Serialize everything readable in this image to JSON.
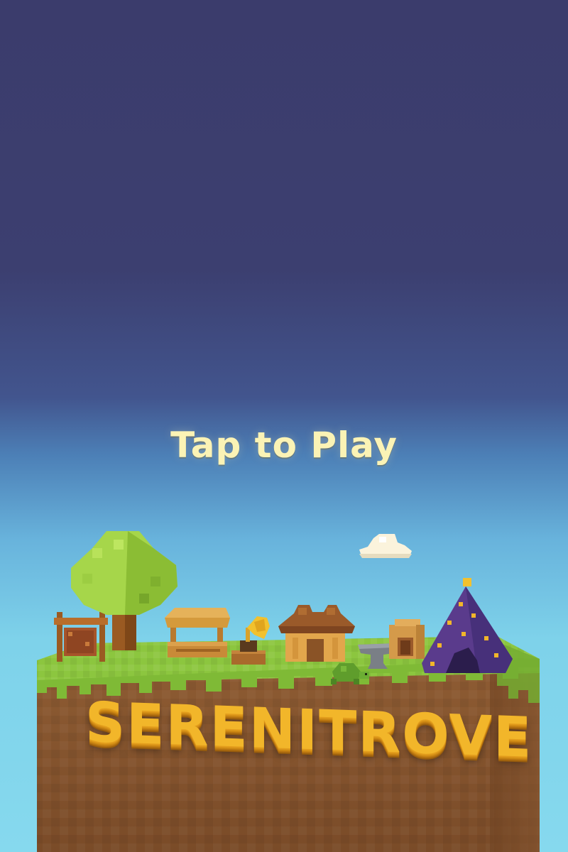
{
  "screen": {
    "tap_prompt": "Tap to Play",
    "game_title": "SERENITROVE"
  },
  "colors": {
    "sky_top": "#3b3c6c",
    "sky_bottom": "#86d9ee",
    "prompt_text": "#fbf3b5",
    "logo_gold": "#f2b62a",
    "grass": "#8cc63f",
    "dirt": "#8a5a33",
    "tent_purple": "#5a3b8c"
  },
  "icons": [
    "cloud-icon",
    "tree-icon",
    "notice-board-icon",
    "market-stall-icon",
    "gramophone-icon",
    "wooden-house-icon",
    "anvil-icon",
    "furnace-icon",
    "wizard-tent-icon",
    "turtle-icon"
  ]
}
